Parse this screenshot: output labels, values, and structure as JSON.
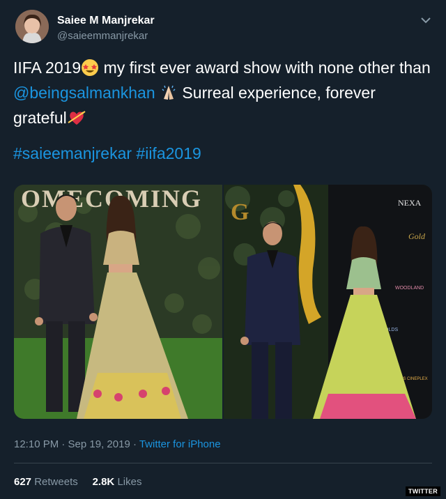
{
  "user": {
    "name": "Saiee M Manjrekar",
    "handle": "@saieemmanjrekar"
  },
  "tweet": {
    "part1": "IIFA 2019",
    "part2": " my first ever award show with none other than ",
    "mention": "@beingsalmankhan",
    "part3": " Surreal experience, forever grateful",
    "hashtag1": "#saieemanjrekar",
    "hashtag2": "#iifa2019"
  },
  "images": {
    "left_banner": "OMECOMING",
    "right_logo": "G",
    "sponsors": [
      "NEXA",
      "Gold",
      "WOODLAND",
      "HOLDS",
      "COLORS CINEPLEX"
    ]
  },
  "meta": {
    "time": "12:10 PM · Sep 19, 2019 · ",
    "source": "Twitter for iPhone"
  },
  "stats": {
    "retweets_count": "627",
    "retweets_label": "Retweets",
    "likes_count": "2.8K",
    "likes_label": "Likes"
  },
  "watermark": "TWITTER",
  "colors": {
    "background": "#15202b",
    "link": "#1b95e0",
    "secondary_text": "#8899a6"
  },
  "icons": [
    "chevron-down-icon",
    "star-struck-emoji",
    "folded-hands-emoji",
    "heart-with-arrow-emoji"
  ]
}
